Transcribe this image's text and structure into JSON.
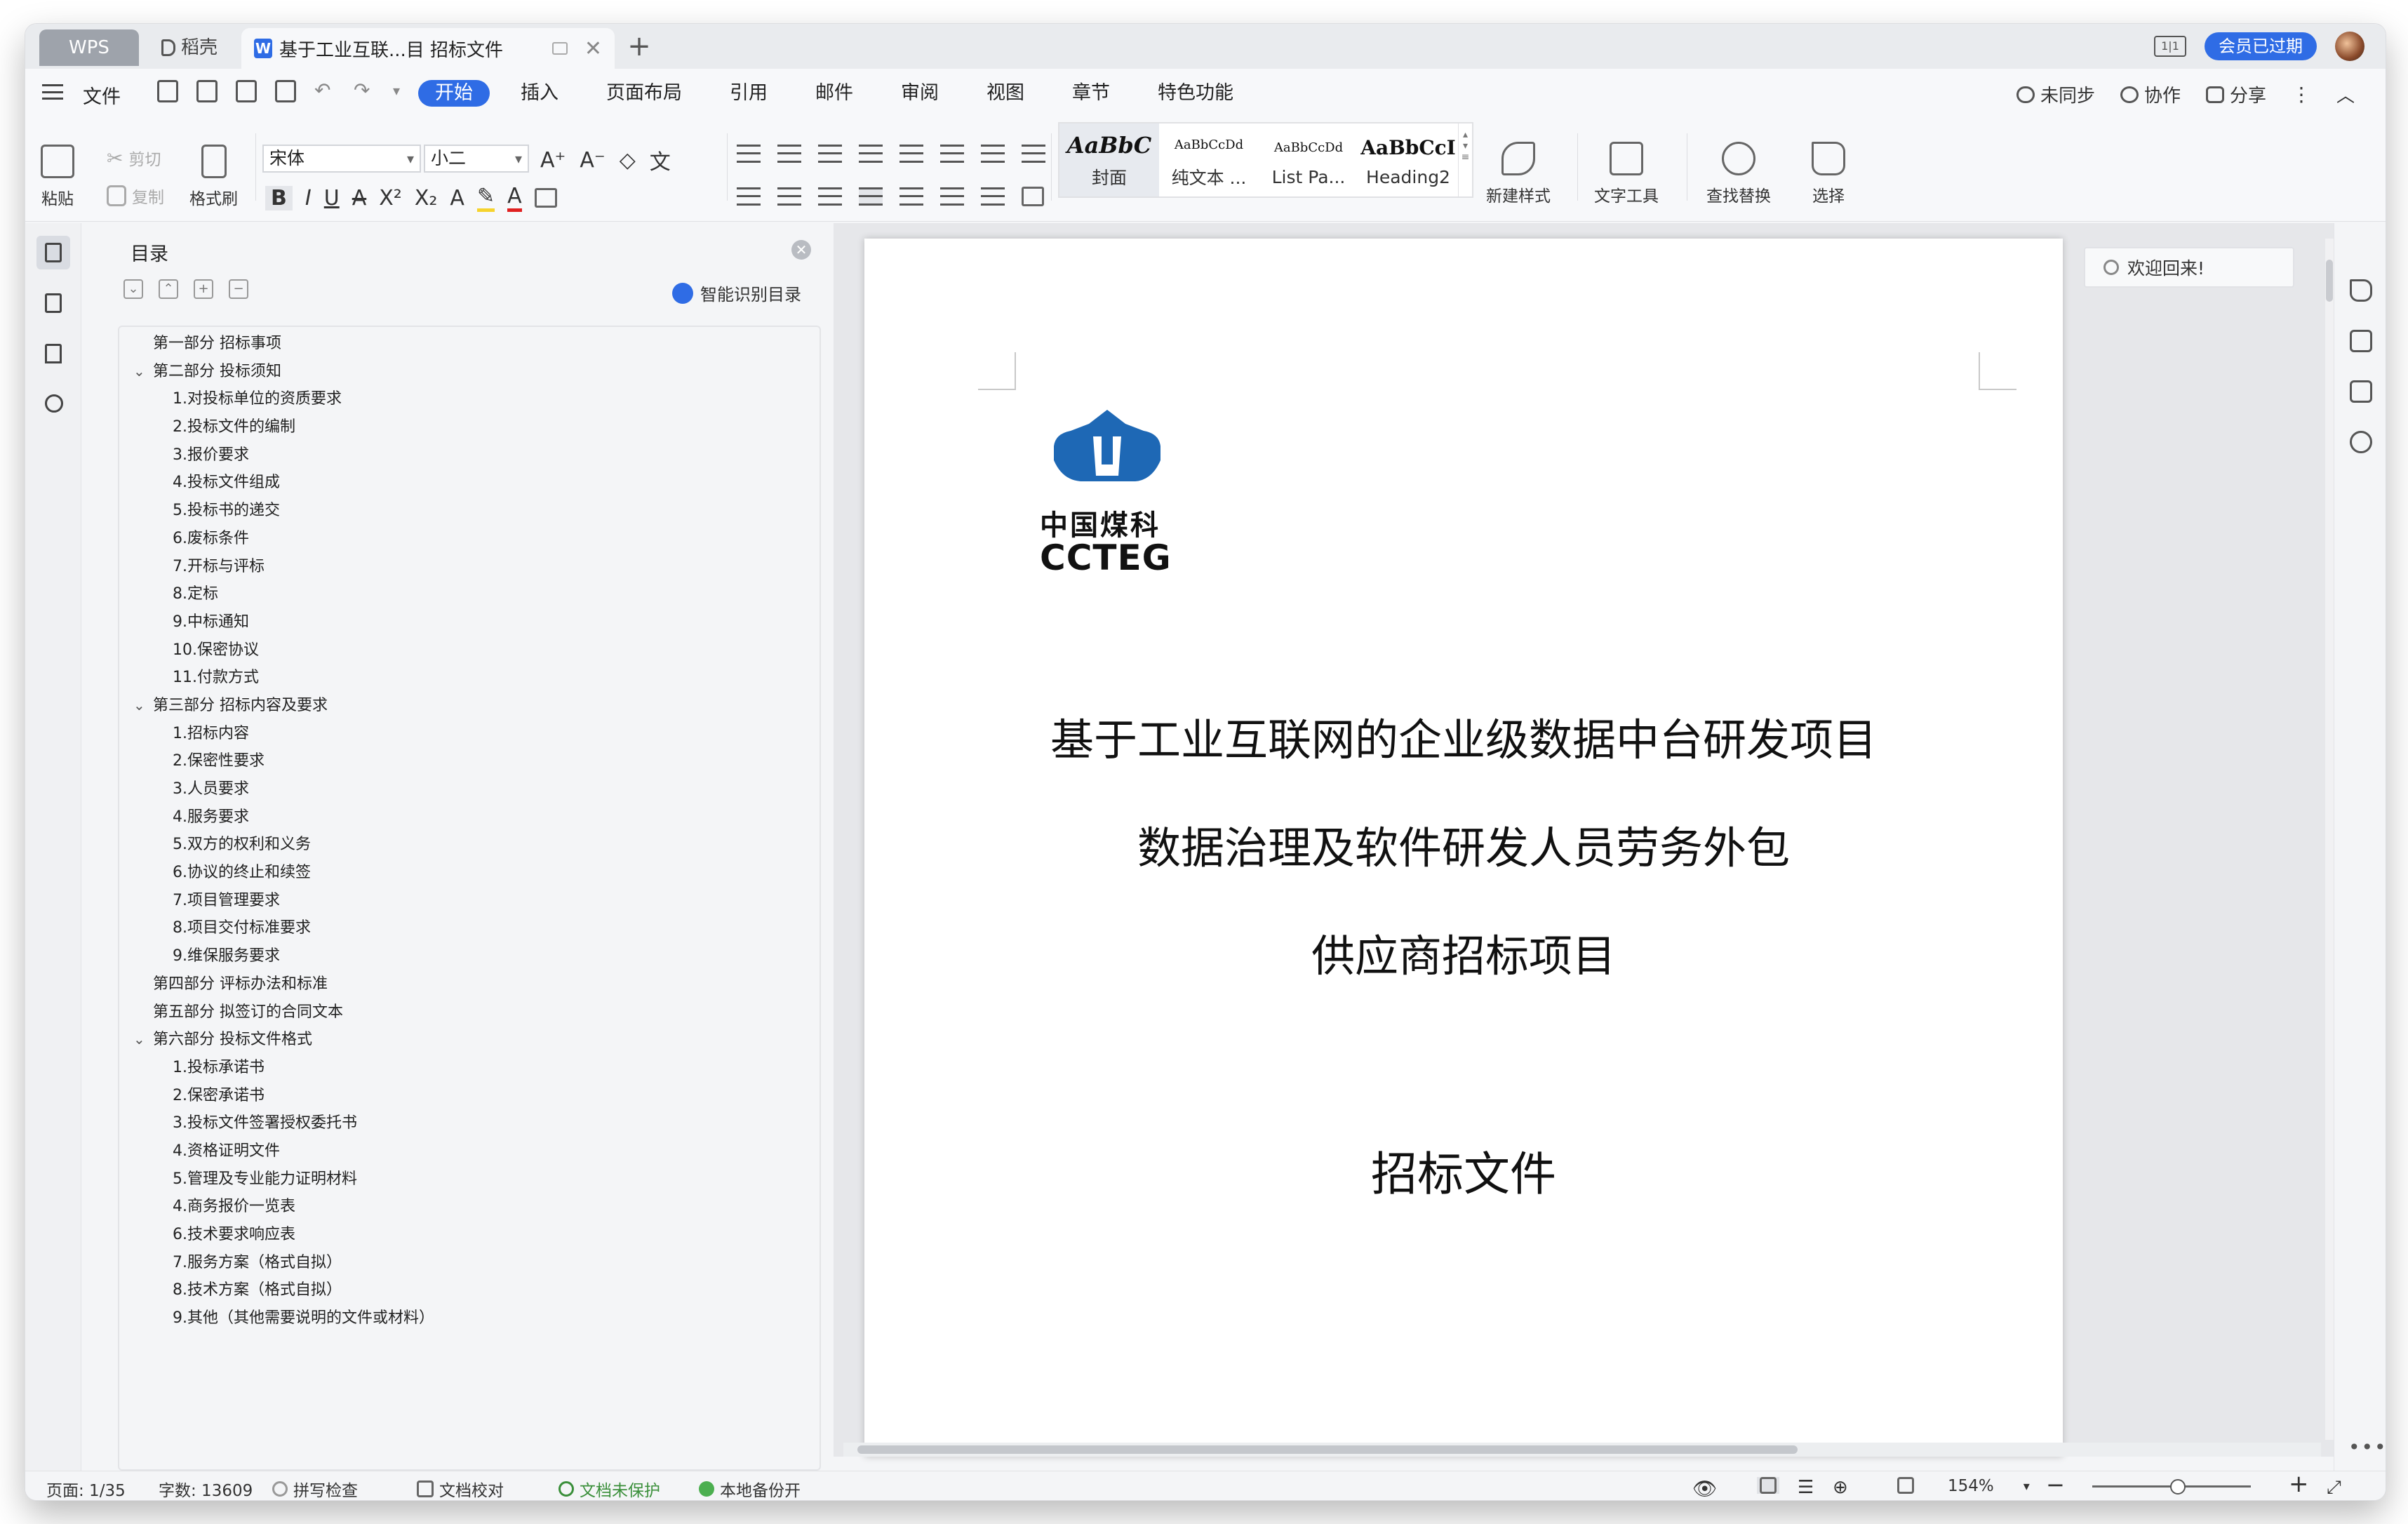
{
  "titlebar": {
    "wps_tab": "WPS",
    "daoke_tab": "稻壳",
    "doc_tab": "基于工业互联...目 招标文件",
    "new_tab": "+",
    "member": "会员已过期",
    "layout_label": "1|1"
  },
  "menubar": {
    "file": "文件",
    "tabs": [
      "开始",
      "插入",
      "页面布局",
      "引用",
      "邮件",
      "审阅",
      "视图",
      "章节",
      "特色功能"
    ],
    "active_tab": "开始",
    "right": {
      "sync": "未同步",
      "collab": "协作",
      "share": "分享"
    }
  },
  "ribbon": {
    "paste": "粘贴",
    "cut": "剪切",
    "copy": "复制",
    "format_painter": "格式刷",
    "font": "宋体",
    "size": "小二",
    "style_previews": [
      "AaBbC",
      "AaBbCcDd",
      "AaBbCcDd",
      "AaBbCcI"
    ],
    "styles": [
      "封面",
      "纯文本 ...",
      "List Pa...",
      "Heading2"
    ],
    "new_style": "新建样式",
    "text_tools": "文字工具",
    "find_replace": "查找替换",
    "select": "选择"
  },
  "toc": {
    "title": "目录",
    "smart": "智能识别目录",
    "items": [
      {
        "text": "第一部分  招标事项",
        "level": 1,
        "expand": false
      },
      {
        "text": "第二部分  投标须知",
        "level": 1,
        "expand": true
      },
      {
        "text": "1.对投标单位的资质要求",
        "level": 2
      },
      {
        "text": "2.投标文件的编制",
        "level": 2
      },
      {
        "text": "3.报价要求",
        "level": 2
      },
      {
        "text": "4.投标文件组成",
        "level": 2
      },
      {
        "text": "5.投标书的递交",
        "level": 2
      },
      {
        "text": "6.废标条件",
        "level": 2
      },
      {
        "text": "7.开标与评标",
        "level": 2
      },
      {
        "text": "8.定标",
        "level": 2
      },
      {
        "text": "9.中标通知",
        "level": 2
      },
      {
        "text": "10.保密协议",
        "level": 2
      },
      {
        "text": "11.付款方式",
        "level": 2
      },
      {
        "text": "第三部分  招标内容及要求",
        "level": 1,
        "expand": true
      },
      {
        "text": "1.招标内容",
        "level": 2
      },
      {
        "text": "2.保密性要求",
        "level": 2
      },
      {
        "text": "3.人员要求",
        "level": 2
      },
      {
        "text": "4.服务要求",
        "level": 2
      },
      {
        "text": "5.双方的权利和义务",
        "level": 2
      },
      {
        "text": "6.协议的终止和续签",
        "level": 2
      },
      {
        "text": "7.项目管理要求",
        "level": 2
      },
      {
        "text": "8.项目交付标准要求",
        "level": 2
      },
      {
        "text": "9.维保服务要求",
        "level": 2
      },
      {
        "text": "第四部分  评标办法和标准",
        "level": 1,
        "expand": false
      },
      {
        "text": "第五部分  拟签订的合同文本",
        "level": 1,
        "expand": false
      },
      {
        "text": "第六部分  投标文件格式",
        "level": 1,
        "expand": true
      },
      {
        "text": "1.投标承诺书",
        "level": 2
      },
      {
        "text": "2.保密承诺书",
        "level": 2
      },
      {
        "text": "3.投标文件签署授权委托书",
        "level": 2
      },
      {
        "text": "4.资格证明文件",
        "level": 2
      },
      {
        "text": "5.管理及专业能力证明材料",
        "level": 2
      },
      {
        "text": "4.商务报价一览表",
        "level": 2
      },
      {
        "text": "6.技术要求响应表",
        "level": 2
      },
      {
        "text": "7.服务方案（格式自拟）",
        "level": 2
      },
      {
        "text": "8.技术方案（格式自拟）",
        "level": 2
      },
      {
        "text": "9.其他（其他需要说明的文件或材料）",
        "level": 2
      }
    ]
  },
  "document": {
    "logo_cn": "中国煤科",
    "logo_en": "CCTEG",
    "line1": "基于工业互联网的企业级数据中台研发项目",
    "line2": "数据治理及软件研发人员劳务外包",
    "line3": "供应商招标项目",
    "line4": "招标文件"
  },
  "tip": "欢迎回来!",
  "status": {
    "page": "页面: 1/35",
    "words": "字数: 13609",
    "spell": "拼写检查",
    "proof": "文档校对",
    "protect": "文档未保护",
    "backup": "本地备份开",
    "zoom": "154%",
    "zoom_level": 0.54
  },
  "colors": {
    "accent": "#2f6ce5",
    "logo_blue": "#1e68b5",
    "ok_green": "#3a8f3a"
  }
}
